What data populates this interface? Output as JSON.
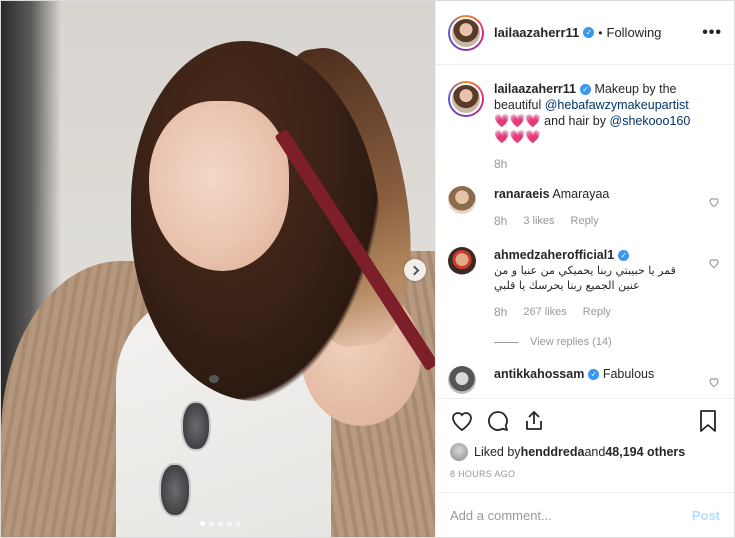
{
  "post": {
    "author": "laila​azaherr11",
    "dot": "•",
    "following": "Following",
    "more": "•••"
  },
  "caption": {
    "user": "laila​azaherr11",
    "text_1": "Makeup by the beautiful ",
    "mention_1": "@hebafawzymakeupartist",
    "text_2": " 💗💗💗 and hair by ",
    "mention_2": "@shekooo160",
    "text_3": " 💗💗💗",
    "time": "8h"
  },
  "comments": [
    {
      "user": "ranaraeis",
      "text": "Amarayaa",
      "time": "8h",
      "likes": "3 likes",
      "reply": "Reply",
      "verified": false
    },
    {
      "user": "ahmedzaherofficial1",
      "text": "قمر يا حبيبتي ربنا يحميكي من عنيا و من عنين الجميع ربنا يحرسك يا قلبي",
      "time": "8h",
      "likes": "267 likes",
      "reply": "Reply",
      "view_replies": "View replies (14)",
      "verified": true
    },
    {
      "user": "antikkahossam",
      "text": "Fabulous",
      "verified": true
    }
  ],
  "likes": {
    "prefix": "Liked by ",
    "user": "henddreda",
    "and": " and ",
    "count": "48,194 others"
  },
  "time_ago": "8 HOURS AGO",
  "add_comment": {
    "placeholder": "Add a comment...",
    "post": "Post"
  },
  "colors": {
    "verified": "#3897f0",
    "mention": "#003569",
    "post_disabled": "#b2dffc"
  },
  "icons": [
    "heart-icon",
    "comment-icon",
    "share-icon",
    "bookmark-icon",
    "chevron-right-icon",
    "more-icon"
  ]
}
